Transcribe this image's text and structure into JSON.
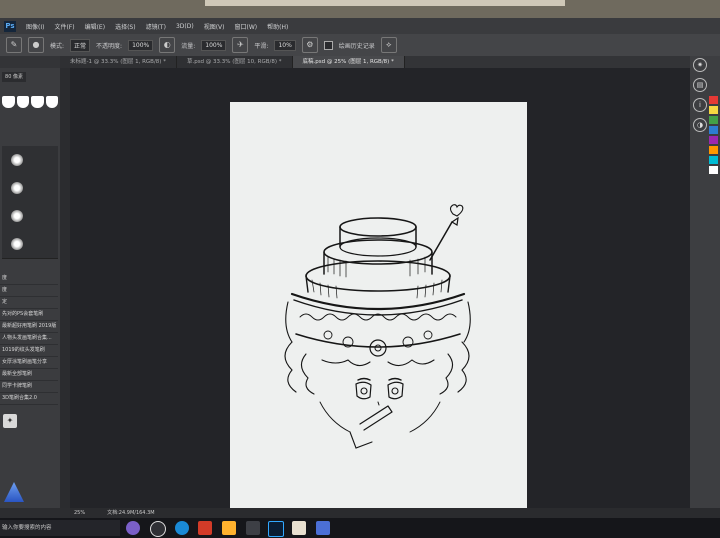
{
  "menubar": {
    "logo": "Ps",
    "items": [
      "图像(I)",
      "文件(F)",
      "编辑(E)",
      "选择(S)",
      "滤镜(T)",
      "3D(D)",
      "视图(V)",
      "窗口(W)",
      "帮助(H)"
    ]
  },
  "options": {
    "mode_label": "模式:",
    "mode_value": "正常",
    "opacity_label": "不透明度:",
    "opacity_value": "100%",
    "flow_label": "流量:",
    "flow_value": "100%",
    "smooth_label": "平滑:",
    "smooth_value": "10%",
    "history_label": "绘画历史记录"
  },
  "tabs": [
    {
      "label": "未标题-1 @ 33.3% (图层 1, RGB/8) *"
    },
    {
      "label": "草.psd @ 33.3% (图层 10, RGB/8) *"
    },
    {
      "label": "底稿.psd @ 25% (图层 1, RGB/8) *"
    }
  ],
  "left_panel": {
    "preset_label": "80 像素",
    "history_items": [
      "度",
      "度",
      "定",
      "先对的PS会套笔刷",
      "最新超好用笔刷 2019版",
      "人物头发画笔刷合集...",
      "1019的纹头发笔刷",
      "女厚涂笔刷画笔分享",
      "最新全部笔刷",
      "同学卡牌笔刷",
      "3D笔刷合集2.0"
    ]
  },
  "status": {
    "zoom": "25%",
    "doc_info": "文档:24.9M/164.3M"
  },
  "taskbar": {
    "search_placeholder": "输入你要搜索的内容"
  },
  "colors": {
    "swatches": [
      "#e53935",
      "#f5d742",
      "#43a047",
      "#2e7dd1",
      "#9c27b0",
      "#ff9800",
      "#00bcd4",
      "#ffffff"
    ]
  }
}
